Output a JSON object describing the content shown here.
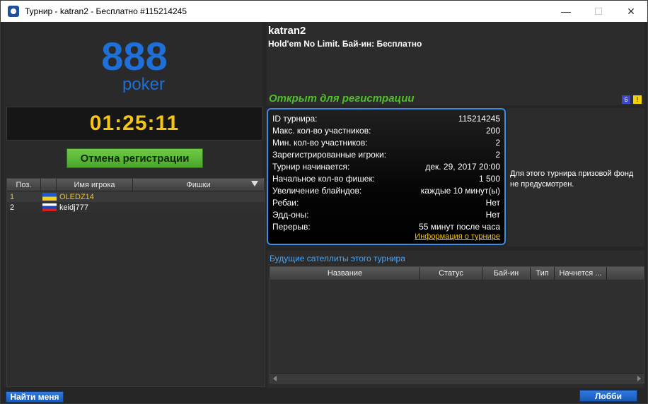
{
  "window": {
    "title": "Турнир - katran2 - Бесплатно #115214245",
    "minimize": "—",
    "maximize": "☐",
    "close": "✕"
  },
  "logo": {
    "line1": "888",
    "line2": "poker",
    "color": "#1e6fd8"
  },
  "timer": "01:25:11",
  "cancel_button": "Отмена регистрации",
  "players": {
    "headers": {
      "pos": "Поз.",
      "name": "Имя игрока",
      "chips": "Фишки"
    },
    "rows": [
      {
        "pos": "1",
        "flag": "ua",
        "name": "OLEDZ14"
      },
      {
        "pos": "2",
        "flag": "ru",
        "name": "keidj777"
      }
    ]
  },
  "find_me_button": "Найти меня",
  "tournament": {
    "name": "katran2",
    "subtitle": "Hold'em No Limit. Бай-ин: Бесплатно",
    "status": "Открыт для регистрации",
    "icon_blue": "6",
    "icon_yellow": "!"
  },
  "info": {
    "rows": [
      {
        "label": "ID турнира:",
        "value": "115214245"
      },
      {
        "label": "Макс. кол-во участников:",
        "value": "200"
      },
      {
        "label": "Мин. кол-во участников:",
        "value": "2"
      },
      {
        "label": "Зарегистрированные игроки:",
        "value": "2"
      },
      {
        "label": "Турнир начинается:",
        "value": "дек. 29, 2017 20:00"
      },
      {
        "label": "Начальное кол-во фишек:",
        "value": "1 500"
      },
      {
        "label": "Увеличение блайндов:",
        "value": "каждые 10 минут(ы)"
      },
      {
        "label": "Ребаи:",
        "value": "Нет"
      },
      {
        "label": "Эдд-оны:",
        "value": "Нет"
      },
      {
        "label": "Перерыв:",
        "value": "55 минут после часа"
      }
    ],
    "link": "Информация о турнире"
  },
  "prize_note": "Для этого турнира призовой фонд не предусмотрен.",
  "satellites": {
    "title": "Будущие сателлиты этого турнира",
    "headers": [
      "Название",
      "Статус",
      "Бай-ин",
      "Тип",
      "Начнется ..."
    ]
  },
  "lobby_button": "Лобби"
}
